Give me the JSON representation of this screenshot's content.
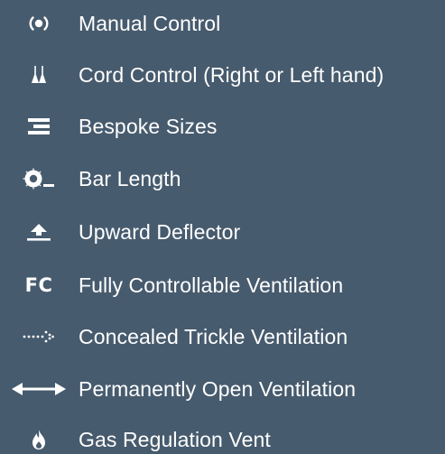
{
  "features": [
    {
      "icon": "radio-signal-icon",
      "label": "Manual Control"
    },
    {
      "icon": "cord-pulls-icon",
      "label": "Cord Control (Right or Left hand)"
    },
    {
      "icon": "stacked-bars-icon",
      "label": "Bespoke Sizes"
    },
    {
      "icon": "bar-length-icon",
      "label": "Bar Length"
    },
    {
      "icon": "upward-arrow-icon",
      "label": "Upward Deflector"
    },
    {
      "icon": "fc-icon",
      "label": "Fully Controllable Ventilation",
      "icon_text": "FC"
    },
    {
      "icon": "dotted-arrow-icon",
      "label": "Concealed Trickle Ventilation"
    },
    {
      "icon": "double-arrow-icon",
      "label": "Permanently Open Ventilation"
    },
    {
      "icon": "flame-icon",
      "label": "Gas Regulation Vent"
    }
  ],
  "colors": {
    "background": "#475b6e",
    "text": "#ffffff"
  }
}
